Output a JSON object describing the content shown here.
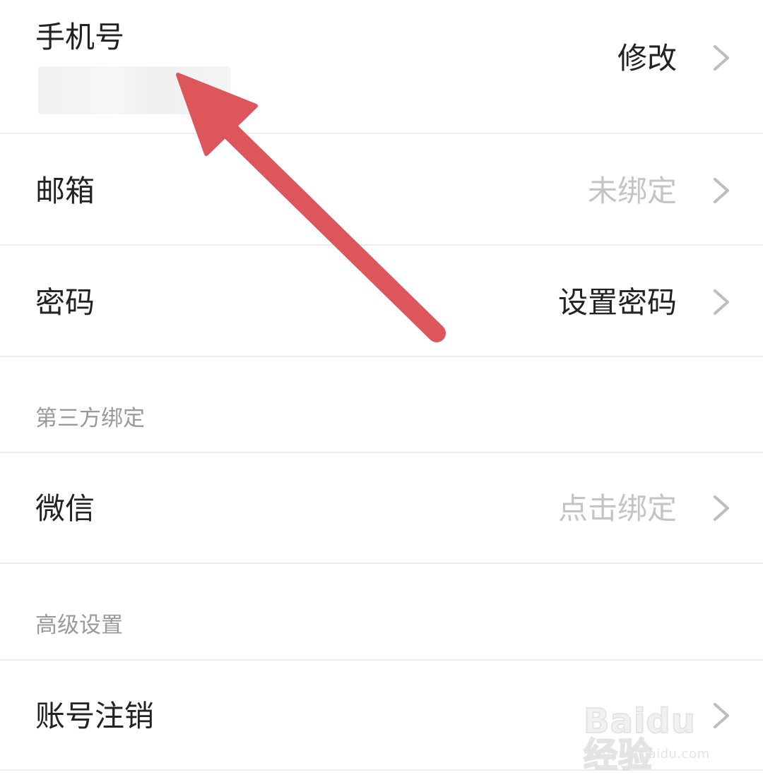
{
  "rows": {
    "phone": {
      "label": "手机号",
      "action": "修改"
    },
    "email": {
      "label": "邮箱",
      "status": "未绑定"
    },
    "password": {
      "label": "密码",
      "action": "设置密码"
    }
  },
  "sections": {
    "third_party": {
      "title": "第三方绑定",
      "wechat": {
        "label": "微信",
        "status": "点击绑定"
      }
    },
    "advanced": {
      "title": "高级设置",
      "deactivate": {
        "label": "账号注销"
      }
    }
  },
  "watermark": {
    "logo": "Baidu经验",
    "url": "jingyan.baidu.com"
  },
  "colors": {
    "annotation_arrow": "#dc565c",
    "muted_text": "#c4c4c4",
    "divider": "#ececec"
  },
  "icons": {
    "row_chevron": "chevron-right-icon",
    "annotation": "arrow-annotation"
  }
}
